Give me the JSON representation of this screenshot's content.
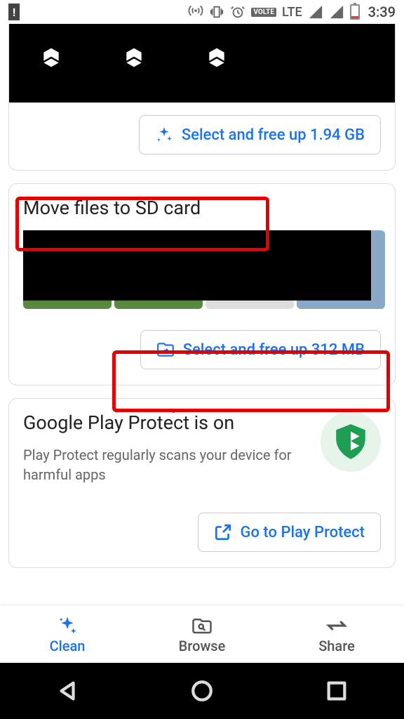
{
  "status": {
    "lte": "LTE",
    "time": "3:39"
  },
  "cards": {
    "cleanup": {
      "button": "Select and free up 1.94 GB"
    },
    "move_sd": {
      "title": "Move files to SD card",
      "button": "Select and free up 312 MB"
    },
    "play_protect": {
      "title": "Google Play Protect is on",
      "subtitle": "Play Protect regularly scans your device for harmful apps",
      "button": "Go to Play Protect"
    }
  },
  "tabs": {
    "clean": "Clean",
    "browse": "Browse",
    "share": "Share"
  }
}
